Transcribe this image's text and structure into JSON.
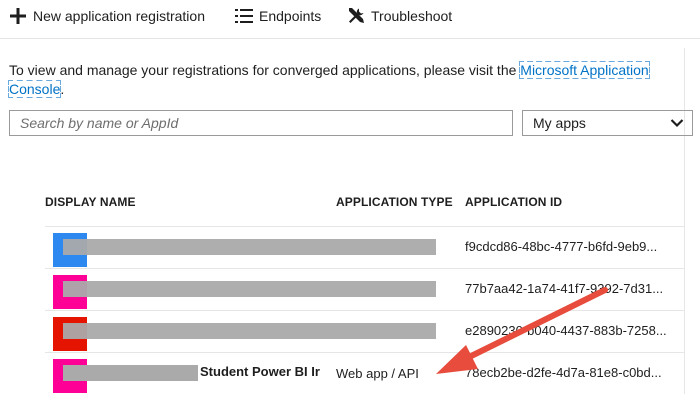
{
  "toolbar": {
    "new_registration": "New application registration",
    "endpoints": "Endpoints",
    "troubleshoot": "Troubleshoot"
  },
  "info": {
    "text": "To view and manage your registrations for converged applications, please visit the ",
    "link": "Microsoft Application Console",
    "suffix": "."
  },
  "search": {
    "placeholder": "Search by name or AppId"
  },
  "filter": {
    "selected": "My apps"
  },
  "table": {
    "headers": {
      "name": "DISPLAY NAME",
      "type": "APPLICATION TYPE",
      "id": "APPLICATION ID"
    },
    "rows": [
      {
        "avatar_color": "#2d89ef",
        "app_id": "f9cdcd86-48bc-4777-b6fd-9eb9..."
      },
      {
        "avatar_color": "#ff0097",
        "app_id": "77b7aa42-1a74-41f7-9392-7d31..."
      },
      {
        "avatar_color": "#e51400",
        "app_id": "e2890230-b040-4437-883b-7258..."
      },
      {
        "avatar_color": "#ff0097",
        "name": "Student Power BI Ir",
        "type": "Web app / API",
        "app_id": "78ecb2be-d2fe-4d7a-81e8-c0bd..."
      }
    ]
  },
  "colors": {
    "accent": "#0072c6",
    "arrow": "#e74c3c"
  }
}
